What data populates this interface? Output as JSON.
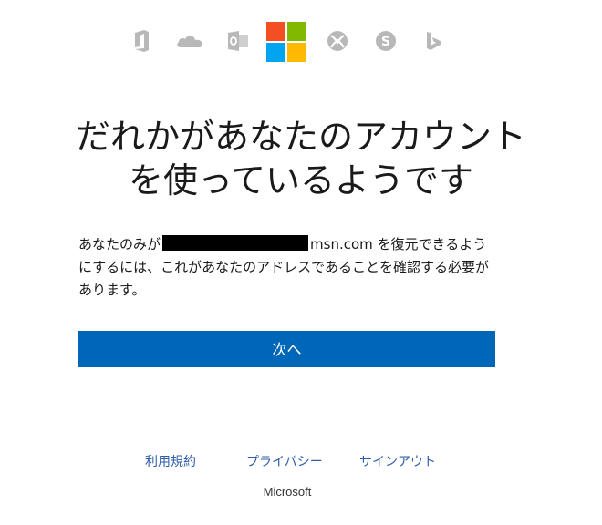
{
  "header": {
    "icons": [
      "office-icon",
      "onedrive-icon",
      "outlook-icon",
      "microsoft-logo",
      "xbox-icon",
      "skype-icon",
      "bing-icon"
    ],
    "logo_colors": [
      "#f25022",
      "#7fba00",
      "#00a4ef",
      "#ffb900"
    ],
    "icon_color": "#b8b8b8"
  },
  "main": {
    "title_line1": "だれかがあなたのアカウント",
    "title_line2": "を使っているようです",
    "desc_prefix": "あなたのみが",
    "desc_suffix": "msn.com を復元できるようにするには、これがあなたのアドレスであることを確認する必要があります。"
  },
  "actions": {
    "next_label": "次へ",
    "accent": "#0067b8"
  },
  "footer": {
    "terms": "利用規約",
    "privacy": "プライバシー",
    "signout": "サインアウト",
    "brand": "Microsoft"
  }
}
